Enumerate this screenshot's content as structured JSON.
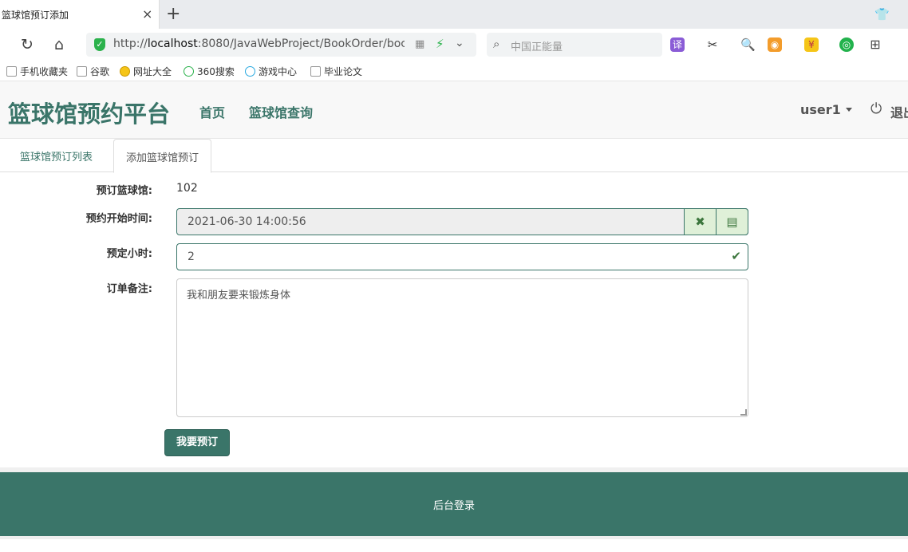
{
  "browser": {
    "tab_title": "篮球馆预订添加",
    "tab_close": "×",
    "new_tab": "+",
    "url_prefix": "http://",
    "url_host": "localhost",
    "url_rest": ":8080/JavaWebProject/BookOrder/boc",
    "search_placeholder": "中国正能量",
    "translate_label": "译",
    "icons": [
      "back-icon",
      "refresh-icon",
      "home-icon",
      "shield-icon",
      "qr-icon",
      "bolt-icon",
      "chevron-down-icon",
      "search-icon",
      "scissors-icon",
      "magnifier-icon",
      "game-icon",
      "coin-icon",
      "wechat-icon",
      "apps-icon"
    ]
  },
  "bookmarks": [
    {
      "label": "手机收藏夹"
    },
    {
      "label": "谷歌"
    },
    {
      "label": "网址大全"
    },
    {
      "label": "360搜索"
    },
    {
      "label": "游戏中心"
    },
    {
      "label": "毕业论文"
    }
  ],
  "header": {
    "brand": "篮球馆预约平台",
    "menu": [
      "首页",
      "篮球馆查询"
    ],
    "user": "user1",
    "logout": "退出"
  },
  "tabs": {
    "list_label": "篮球馆预订列表",
    "active_label": "添加篮球馆预订"
  },
  "form": {
    "venue_label": "预订篮球馆:",
    "venue_value": "102",
    "start_label": "预约开始时间:",
    "start_value": "2021-06-30 14:00:56",
    "hours_label": "预定小时:",
    "hours_value": "2",
    "note_label": "订单备注:",
    "note_value": "我和朋友要来锻炼身体",
    "submit_label": "我要预订"
  },
  "footer": {
    "admin_login": "后台登录"
  },
  "colors": {
    "brand": "#3a7569",
    "success_addon": "#dff0d8",
    "success_text": "#3c763d"
  }
}
